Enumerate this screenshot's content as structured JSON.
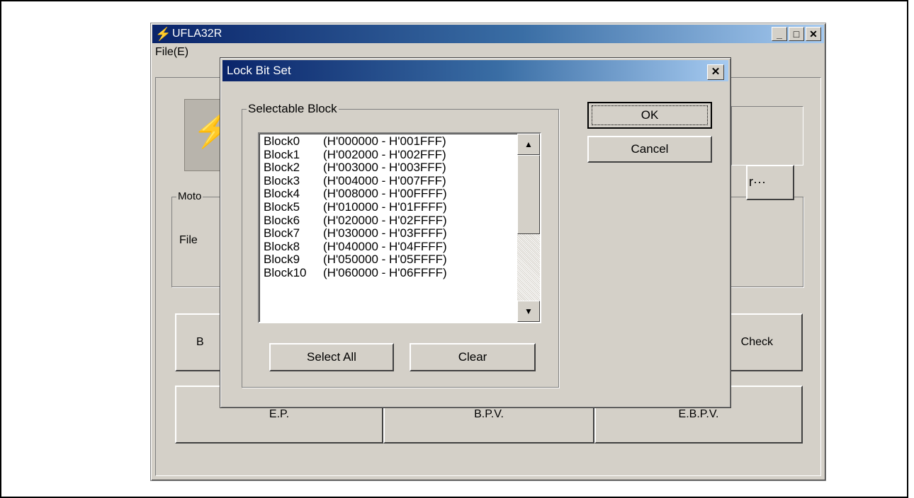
{
  "main_window": {
    "title": "UFLA32R",
    "menu_file": "File(E)",
    "group_label": "Moto",
    "file_label": "File",
    "browse_label": "r···",
    "row1": {
      "left_label": "B",
      "right_label": "Check"
    },
    "row2": {
      "ep_label": "E.P.",
      "bpv_label": "B.P.V.",
      "ebpv_label": "E.B.P.V."
    }
  },
  "dialog": {
    "title": "Lock Bit Set",
    "group_label": "Selectable Block",
    "ok_label": "OK",
    "cancel_label": "Cancel",
    "select_all_label": "Select All",
    "clear_label": "Clear",
    "blocks": [
      {
        "name": "Block0",
        "range": "(H'000000 - H'001FFF)"
      },
      {
        "name": "Block1",
        "range": "(H'002000 - H'002FFF)"
      },
      {
        "name": "Block2",
        "range": "(H'003000 - H'003FFF)"
      },
      {
        "name": "Block3",
        "range": "(H'004000 - H'007FFF)"
      },
      {
        "name": "Block4",
        "range": "(H'008000 - H'00FFFF)"
      },
      {
        "name": "Block5",
        "range": "(H'010000 - H'01FFFF)"
      },
      {
        "name": "Block6",
        "range": "(H'020000 - H'02FFFF)"
      },
      {
        "name": "Block7",
        "range": "(H'030000 - H'03FFFF)"
      },
      {
        "name": "Block8",
        "range": "(H'040000 - H'04FFFF)"
      },
      {
        "name": "Block9",
        "range": "(H'050000 - H'05FFFF)"
      },
      {
        "name": "Block10",
        "range": "(H'060000 - H'06FFFF)"
      }
    ]
  }
}
